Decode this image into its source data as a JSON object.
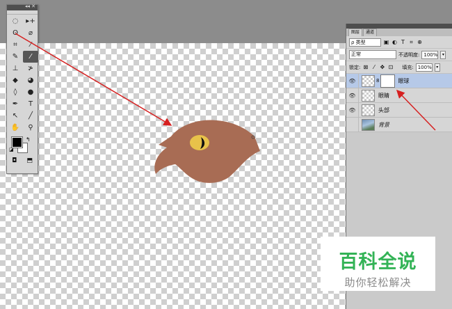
{
  "toolbox": {
    "header_icons": "◂◂ ✕",
    "tools": [
      {
        "icon": "elliptical-marquee-icon",
        "glyph": "◌"
      },
      {
        "icon": "move-icon",
        "glyph": "▸+"
      },
      {
        "icon": "lasso-icon",
        "glyph": "ʘ"
      },
      {
        "icon": "quick-selection-icon",
        "glyph": "⌀"
      },
      {
        "icon": "crop-icon",
        "glyph": "⌗"
      },
      {
        "icon": "eyedropper-icon",
        "glyph": "⁄"
      },
      {
        "icon": "healing-brush-icon",
        "glyph": "✎"
      },
      {
        "icon": "brush-icon",
        "glyph": "⁄",
        "active": true
      },
      {
        "icon": "clone-stamp-icon",
        "glyph": "⊥"
      },
      {
        "icon": "history-brush-icon",
        "glyph": "≯"
      },
      {
        "icon": "eraser-icon",
        "glyph": "◆"
      },
      {
        "icon": "paint-bucket-icon",
        "glyph": "◕"
      },
      {
        "icon": "blur-icon",
        "glyph": "◊"
      },
      {
        "icon": "dodge-icon",
        "glyph": "●"
      },
      {
        "icon": "pen-icon",
        "glyph": "✒"
      },
      {
        "icon": "type-icon",
        "glyph": "T"
      },
      {
        "icon": "path-selection-icon",
        "glyph": "↖"
      },
      {
        "icon": "line-icon",
        "glyph": "╱"
      },
      {
        "icon": "hand-icon",
        "glyph": "✋"
      },
      {
        "icon": "zoom-icon",
        "glyph": "⚲"
      }
    ],
    "bottom": {
      "quick_mask": "◘",
      "screen_mode": "⬒"
    }
  },
  "layers_panel": {
    "tabs": [
      "图层",
      "通道"
    ],
    "filter_kind": "ρ 类型",
    "filter_icons": [
      "▣",
      "◐",
      "T",
      "⌗",
      "⊕"
    ],
    "blend_mode": "正常",
    "opacity_label": "不透明度:",
    "opacity_value": "100%",
    "lock_label": "锁定:",
    "lock_icons": [
      "⊠",
      "⁄",
      "✥",
      "🔒"
    ],
    "fill_label": "填充:",
    "fill_value": "100%",
    "layers": [
      {
        "name": "眼球",
        "selected": true,
        "visible": true,
        "has_mask": true
      },
      {
        "name": "眼睛",
        "selected": false,
        "visible": true,
        "has_mask": false
      },
      {
        "name": "头部",
        "selected": false,
        "visible": true,
        "has_mask": false
      },
      {
        "name": "背景",
        "selected": false,
        "visible": false,
        "has_mask": false,
        "italic": true
      }
    ]
  },
  "watermark": {
    "title": "百科全说",
    "subtitle": "助你轻松解决"
  },
  "colors": {
    "head": "#a86c54",
    "eye": "#e8c24a",
    "annotation": "#d62020",
    "watermark_green": "#33b356",
    "selected_layer": "#b6c9e8"
  }
}
